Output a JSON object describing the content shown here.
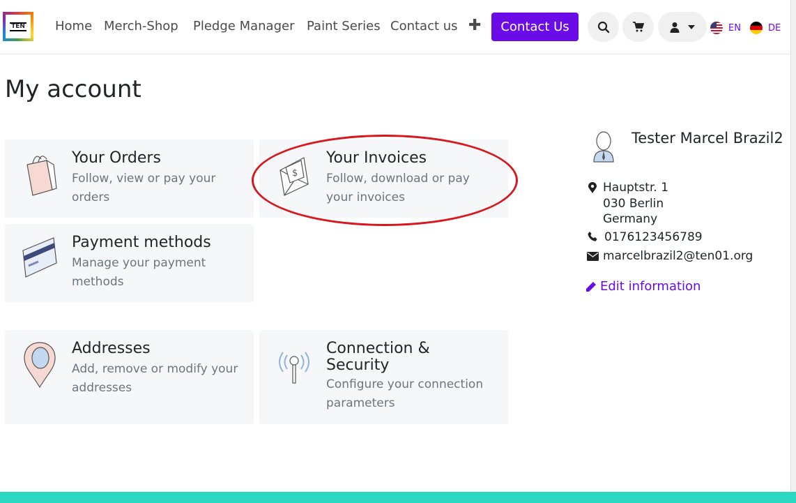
{
  "header": {
    "logo_text": "TEN",
    "nav": [
      "Home",
      "Merch-Shop",
      "Pledge Manager",
      "Paint Series",
      "Contact us"
    ],
    "plus_icon": "plus-icon",
    "contact_button": "Contact Us",
    "lang_en": "EN",
    "lang_de": "DE",
    "accent_color": "#6b0ce8"
  },
  "page": {
    "title": "My account"
  },
  "cards": [
    {
      "title": "Your Orders",
      "desc": "Follow, view or pay your orders",
      "icon": "shopping-bag-icon"
    },
    {
      "title": "Your Invoices",
      "desc": "Follow, download or pay your invoices",
      "icon": "invoice-envelope-icon"
    },
    {
      "title": "Payment methods",
      "desc": "Manage your payment methods",
      "icon": "credit-card-icon"
    },
    {
      "title": "Addresses",
      "desc": "Add, remove or modify your addresses",
      "icon": "map-pin-icon"
    },
    {
      "title": "Connection & Security",
      "desc": "Configure your connection parameters",
      "icon": "antenna-icon"
    }
  ],
  "profile": {
    "name": "Tester Marcel Brazil2",
    "street": "Hauptstr. 1",
    "city": "030 Berlin",
    "country": "Germany",
    "phone": "0176123456789",
    "email": "marcelbrazil2@ten01.org",
    "edit_label": "Edit information"
  },
  "annotation_color": "#d8161b",
  "footer_color": "#2bd9c3"
}
